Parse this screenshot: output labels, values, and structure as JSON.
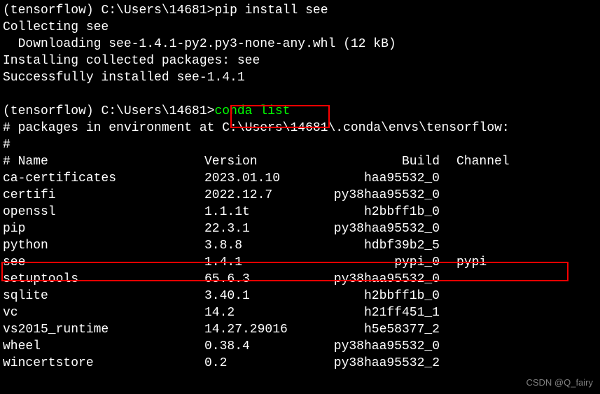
{
  "prompt1": {
    "env": "(tensorflow)",
    "path": "C:\\Users\\14681>",
    "command": "pip install see"
  },
  "pip_output": {
    "collecting": "Collecting see",
    "downloading": "  Downloading see-1.4.1-py2.py3-none-any.whl (12 kB)",
    "installing": "Installing collected packages: see",
    "success": "Successfully installed see-1.4.1"
  },
  "prompt2": {
    "env": "(tensorflow)",
    "path": "C:\\Users\\14681>",
    "command": "conda list"
  },
  "conda_output": {
    "env_line": "# packages in environment at C:\\Users\\14681\\.conda\\envs\\tensorflow:",
    "hash_line": "#",
    "header": {
      "name": "# Name",
      "version": "Version",
      "build": "Build",
      "channel": "Channel"
    },
    "packages": [
      {
        "name": "ca-certificates",
        "version": "2023.01.10",
        "build": "haa95532_0",
        "channel": ""
      },
      {
        "name": "certifi",
        "version": "2022.12.7",
        "build": "py38haa95532_0",
        "channel": ""
      },
      {
        "name": "openssl",
        "version": "1.1.1t",
        "build": "h2bbff1b_0",
        "channel": ""
      },
      {
        "name": "pip",
        "version": "22.3.1",
        "build": "py38haa95532_0",
        "channel": ""
      },
      {
        "name": "python",
        "version": "3.8.8",
        "build": "hdbf39b2_5",
        "channel": ""
      },
      {
        "name": "see",
        "version": "1.4.1",
        "build": "pypi_0",
        "channel": "pypi"
      },
      {
        "name": "setuptools",
        "version": "65.6.3",
        "build": "py38haa95532_0",
        "channel": ""
      },
      {
        "name": "sqlite",
        "version": "3.40.1",
        "build": "h2bbff1b_0",
        "channel": ""
      },
      {
        "name": "vc",
        "version": "14.2",
        "build": "h21ff451_1",
        "channel": ""
      },
      {
        "name": "vs2015_runtime",
        "version": "14.27.29016",
        "build": "h5e58377_2",
        "channel": ""
      },
      {
        "name": "wheel",
        "version": "0.38.4",
        "build": "py38haa95532_0",
        "channel": ""
      },
      {
        "name": "wincertstore",
        "version": "0.2",
        "build": "py38haa95532_2",
        "channel": ""
      }
    ]
  },
  "watermark": "CSDN @Q_fairy"
}
